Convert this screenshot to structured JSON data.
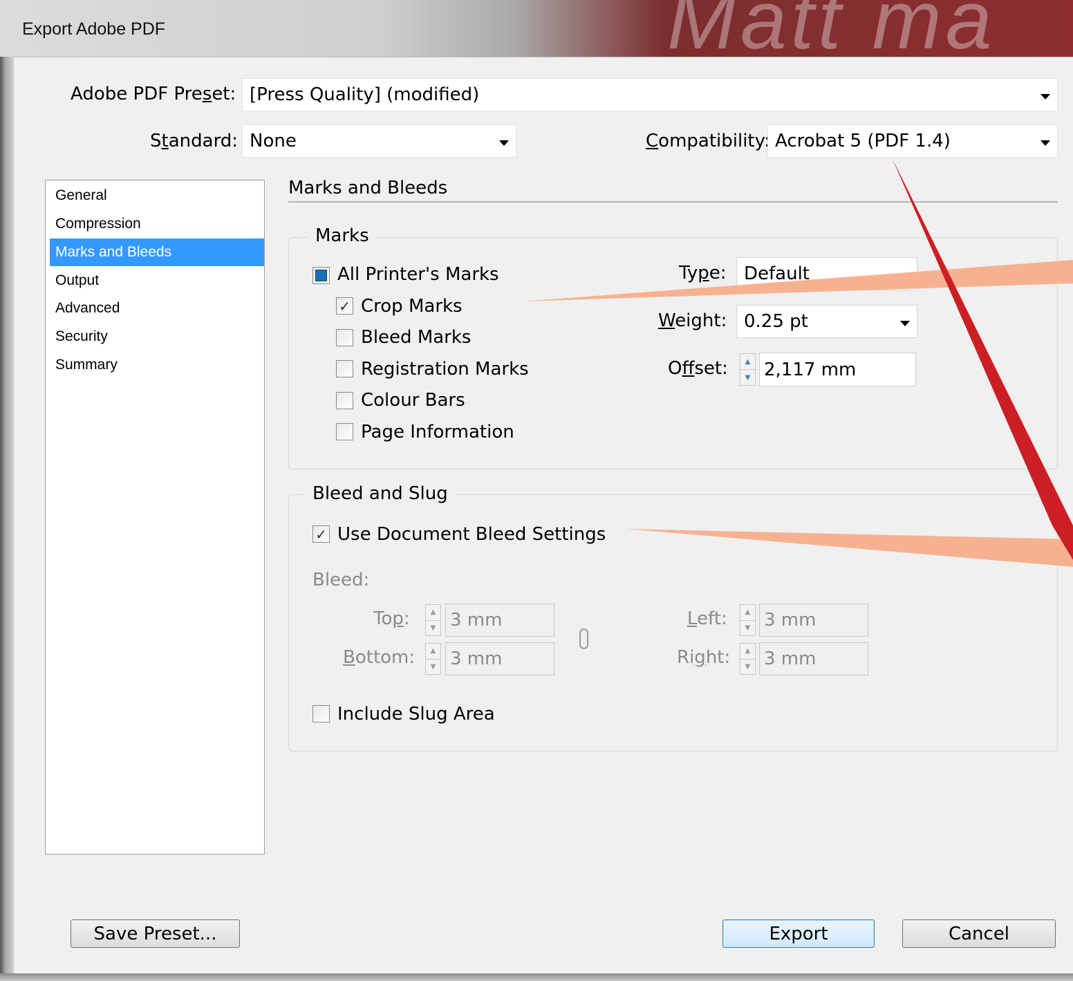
{
  "window": {
    "title": "Export Adobe PDF",
    "watermark_text": "Matt ma"
  },
  "preset": {
    "label": "Adobe PDF Preset:",
    "value": "[Press Quality] (modified)"
  },
  "standard": {
    "label": "Standard:",
    "value": "None"
  },
  "compatibility": {
    "label": "Compatibility:",
    "value": "Acrobat 5 (PDF 1.4)"
  },
  "sidebar": {
    "items": [
      {
        "label": "General"
      },
      {
        "label": "Compression"
      },
      {
        "label": "Marks and Bleeds",
        "selected": true
      },
      {
        "label": "Output"
      },
      {
        "label": "Advanced"
      },
      {
        "label": "Security"
      },
      {
        "label": "Summary"
      }
    ]
  },
  "section": {
    "title": "Marks and Bleeds"
  },
  "marks": {
    "legend": "Marks",
    "all_printers_marks": {
      "label": "All Printer's Marks",
      "state": "indeterminate"
    },
    "crop_marks": {
      "label": "Crop Marks",
      "checked": true
    },
    "bleed_marks": {
      "label": "Bleed Marks",
      "checked": false
    },
    "registration_marks": {
      "label": "Registration Marks",
      "checked": false
    },
    "colour_bars": {
      "label": "Colour Bars",
      "checked": false
    },
    "page_information": {
      "label": "Page Information",
      "checked": false
    },
    "type": {
      "label": "Type:",
      "value": "Default"
    },
    "weight": {
      "label": "Weight:",
      "value": "0.25 pt"
    },
    "offset": {
      "label": "Offset:",
      "value": "2,117 mm"
    }
  },
  "bleed_slug": {
    "legend": "Bleed and Slug",
    "use_document_bleed": {
      "label": "Use Document Bleed Settings",
      "checked": true
    },
    "bleed_label": "Bleed:",
    "top": {
      "label": "Top:",
      "value": "3 mm"
    },
    "bottom": {
      "label": "Bottom:",
      "value": "3 mm"
    },
    "left": {
      "label": "Left:",
      "value": "3 mm"
    },
    "right": {
      "label": "Right:",
      "value": "3 mm"
    },
    "include_slug": {
      "label": "Include Slug Area",
      "checked": false
    }
  },
  "buttons": {
    "save_preset": "Save Preset...",
    "export": "Export",
    "cancel": "Cancel"
  },
  "colors": {
    "selection": "#3399ff",
    "annotation_red": "#cc1f24",
    "annotation_salmon": "#f5b090"
  }
}
